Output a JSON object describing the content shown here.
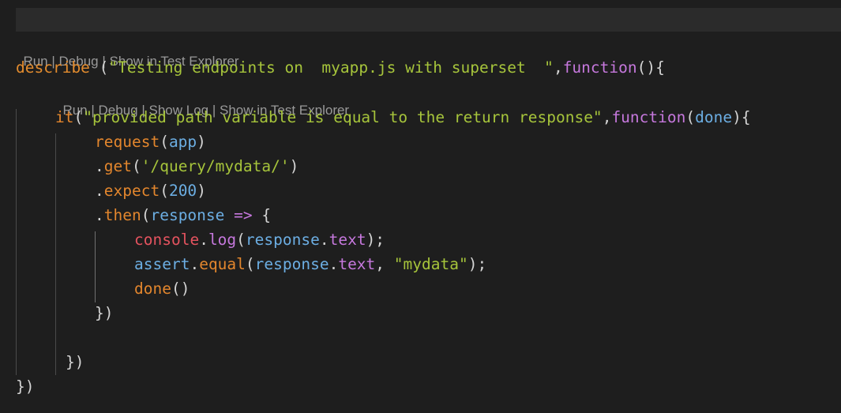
{
  "editor": {
    "codelens_describe": [
      "Run",
      "Debug",
      "Show in Test Explorer"
    ],
    "codelens_it": [
      "Run",
      "Debug",
      "Show Log",
      "Show in Test Explorer"
    ],
    "separator": " | ",
    "code": {
      "l1": {
        "kw": "describe",
        "sp": " (",
        "str": "\"Testing endpoints on  myapp.js with superset  \"",
        "comma": ",",
        "fn": "function",
        "rest": "(){"
      },
      "l2": {
        "kw": "it",
        "open": "(",
        "str": "\"provided path variable is equal to the return response\"",
        "comma": ",",
        "fn": "function",
        "p1": "(",
        "param": "done",
        "p2": "){"
      },
      "l3": {
        "fn": "request",
        "p1": "(",
        "arg": "app",
        "p2": ")"
      },
      "l4": {
        "dot": ".",
        "fn": "get",
        "p1": "(",
        "str": "'/query/mydata/'",
        "p2": ")"
      },
      "l5": {
        "dot": ".",
        "fn": "expect",
        "p1": "(",
        "num": "200",
        "p2": ")"
      },
      "l6": {
        "dot": ".",
        "fn": "then",
        "p1": "(",
        "arg": "response",
        "arrow": " => ",
        "brace": "{"
      },
      "l7": {
        "obj": "console",
        "dot": ".",
        "fn": "log",
        "p1": "(",
        "arg": "response",
        "dot2": ".",
        "prop": "text",
        "p2": ");"
      },
      "l8": {
        "obj": "assert",
        "dot": ".",
        "fn": "equal",
        "p1": "(",
        "arg": "response",
        "dot2": ".",
        "prop": "text",
        "comma": ", ",
        "str": "\"mydata\"",
        "p2": ");"
      },
      "l9": {
        "fn": "done",
        "p": "()"
      },
      "l10": {
        "text": "})"
      },
      "l12": {
        "text": "})"
      },
      "l13": {
        "text": "})"
      }
    }
  }
}
